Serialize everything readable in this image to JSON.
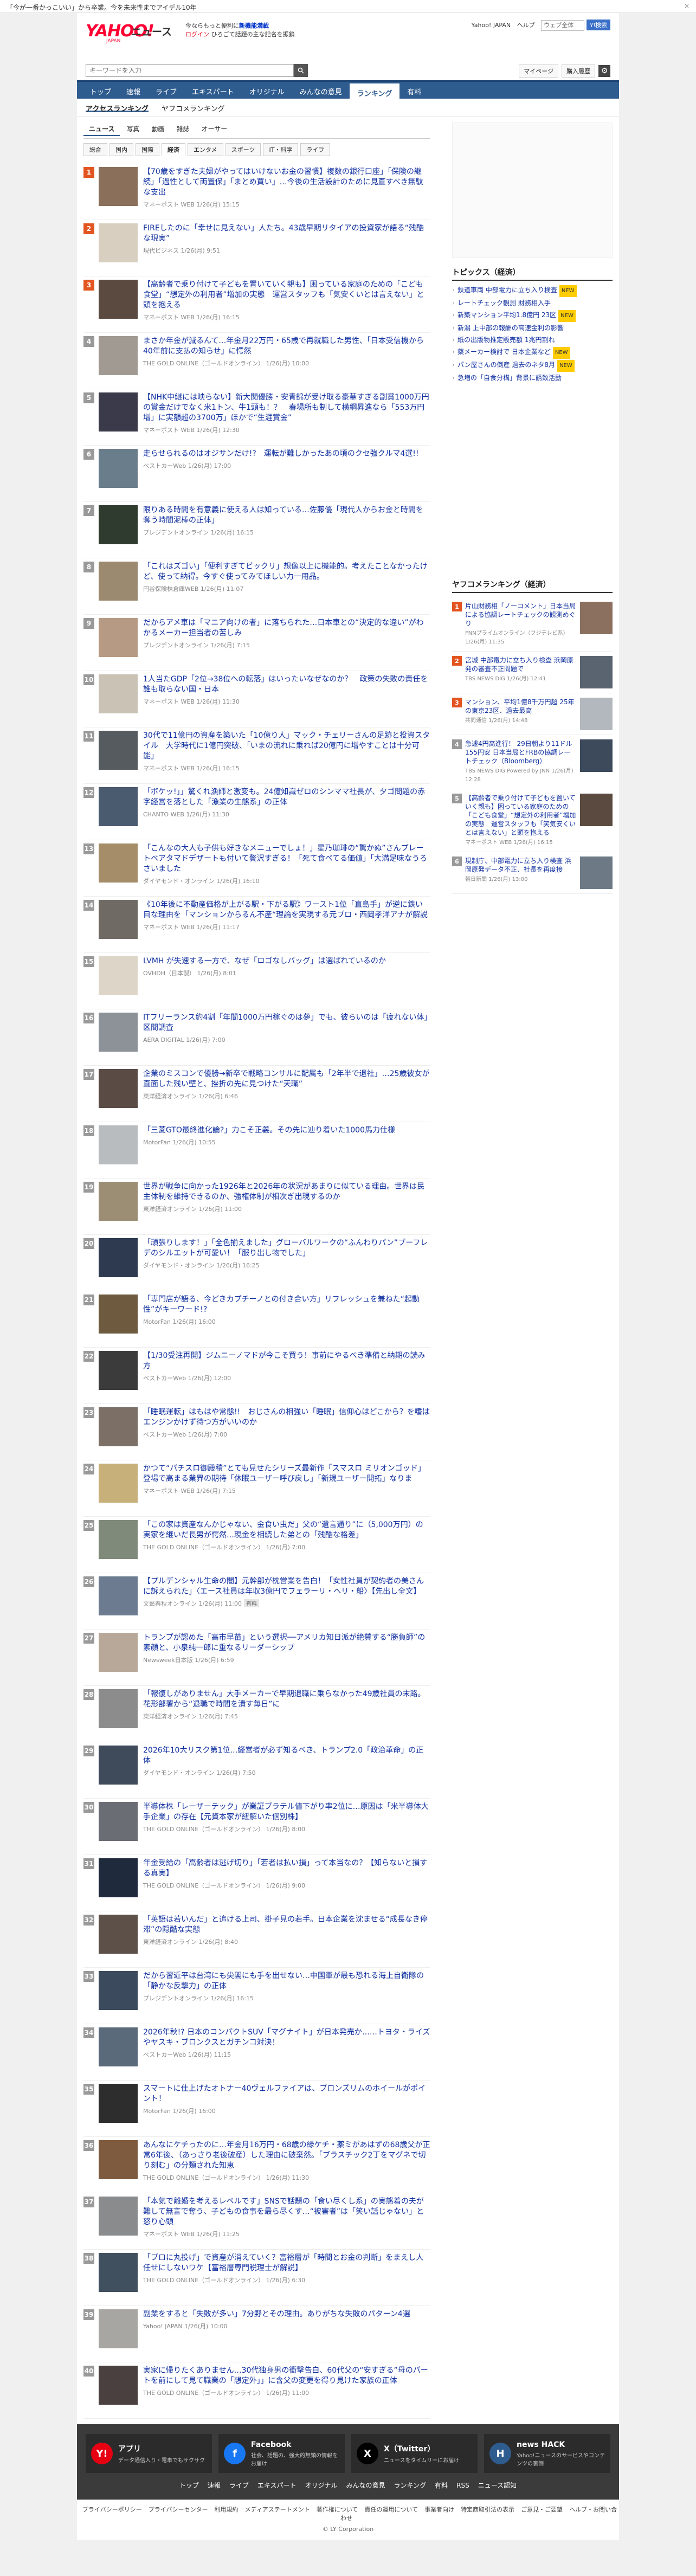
{
  "promo": {
    "text": "「今が一番かっこいい」から卒業。今を未来性までアイデル10年",
    "close": "×"
  },
  "header": {
    "logo": "YAHOO!",
    "logo_sub": "JAPAN",
    "site_name": "ニュース",
    "promo_line1": "今ならもっと便利に",
    "promo_highlight": "新機能満載",
    "promo_line2a": "ログイン",
    "promo_line2b": "ひろごて話題の主な記名を振鎖",
    "links": [
      "Yahoo! JAPAN",
      "ヘルプ"
    ],
    "mini_search_placeholder": "ウェブ全体",
    "mini_search_button": "Y!検索"
  },
  "search": {
    "placeholder": "キーワードを入力",
    "mypage": "マイページ",
    "subscribe": "購入履歴"
  },
  "gnav": [
    "トップ",
    "速報",
    "ライブ",
    "エキスパート",
    "オリジナル",
    "みんなの意見",
    "ランキング",
    "有料"
  ],
  "gnav_active": "ランキング",
  "subtabs": [
    "アクセスランキング",
    "ヤフコメランキング"
  ],
  "genre_tabs": [
    "ニュース",
    "写真",
    "動画",
    "雑誌",
    "オーサー"
  ],
  "sub_genre": [
    "総合",
    "国内",
    "国際",
    "経済",
    "エンタメ",
    "スポーツ",
    "IT・科学",
    "ライフ"
  ],
  "sub_genre_active": "経済",
  "ranking": [
    {
      "n": "1",
      "title": "【70歳をすぎた夫婦がやってはいけないお金の習慣】複数の銀行口座」「保険の継続」「過性として両置保」「まとめ買い」…今後の生活設計のために見直すべき無駄な支出",
      "source": "マネーポスト WEB",
      "time": "1/26(月) 15:15",
      "color": "#8a6f5a"
    },
    {
      "n": "2",
      "title": "FIREしたのに「幸せに見えない」人たち。43歳早期リタイアの投資家が語る“残酷な現実”",
      "source": "現代ビジネス",
      "time": "1/26(月) 9:51",
      "color": "#d8cfc0"
    },
    {
      "n": "3",
      "title": "【高齢者で乗り付けて子どもを置いていく親も】困っている家庭のための「こども食堂」“想定外の利用者”増加の実態　運営スタッフも「気安くいとは言えない」と頭を抱える",
      "source": "マネーポスト WEB",
      "time": "1/26(月) 16:15",
      "color": "#5b4a3f"
    },
    {
      "n": "4",
      "title": "まさか年金が減るんて…年金月22万円・65歳で再就職した男性、「日本受信機から40年前に支払の知らせ」に愕然",
      "source": "THE GOLD ONLINE（ゴールドオンライン）",
      "time": "1/26(月) 10:00",
      "color": "#a09a92"
    },
    {
      "n": "5",
      "title": "【NHK中継には映らない】新大関優勝・安青錦が受け取る豪華すぎる副賞1000万円の賞金だけでなく米1トン、牛1頭も！？　春場所も制して横綱昇進なら「553万円増」に実額超の3700万」ほかで“生涯賞金”",
      "source": "マネーポスト WEB",
      "time": "1/26(月) 12:30",
      "color": "#3a3a4a"
    },
    {
      "n": "6",
      "title": "走らせられるのはオジサンだけ!?　運転が難しかったあの頃のクセ強クルマ4選!!",
      "source": "ベストカーWeb",
      "time": "1/26(月) 17:00",
      "color": "#6a7d8a"
    },
    {
      "n": "7",
      "title": "限りある時間を有意義に使える人は知っている…佐藤優「現代人からお金と時間を奪う時間泥棒の正体」",
      "source": "プレジデントオンライン",
      "time": "1/26(月) 16:15",
      "color": "#2f3b2e"
    },
    {
      "n": "8",
      "title": "「これはズゴい」「便利すぎてビックリ」想像以上に機能的。考えたことなかったけど、使って納得。今すぐ使ってみてほしい力一用品。",
      "source": "円谷保険株倉庫WEB",
      "time": "1/26(月) 11:07",
      "color": "#9b8a70"
    },
    {
      "n": "9",
      "title": "だからアメ車は「マニア向けの者」に落ちられた…日本車との“決定的な違い”がわかるメーカー担当者の苦しみ",
      "source": "プレジデントオンライン",
      "time": "1/26(月) 7:15",
      "color": "#b79a83"
    },
    {
      "n": "10",
      "title": "1人当たGDP「2位→38位への転落」はいったいなぜなのか？　政策の失敗の責任を誰も取らない国・日本",
      "source": "マネーポスト WEB",
      "time": "1/26(月) 11:30",
      "color": "#c9c2b5"
    },
    {
      "n": "11",
      "title": "30代で11億円の資産を築いた「10億り人」マック・チェリーさんの足跡と投資スタイル　大学時代に1億円突破、「いまの流れに乗れば20億円に増やすことは十分可能」",
      "source": "マネーポスト WEB",
      "time": "1/26(月) 16:15",
      "color": "#565b60"
    },
    {
      "n": "12",
      "title": "「ボケッ!」」驚くれ漁師と激変も。24億知識ゼロのシンママ社長が、夕ゴ問題の赤字経営を落とした「漁業の生態系」の正体",
      "source": "CHANTO WEB",
      "time": "1/26(月) 11:30",
      "color": "#4a5a6f"
    },
    {
      "n": "13",
      "title": "「こんなの大人も子供も好きなメニューでしょ！」星乃珈琲の“驚かぬ”さんプレートベアタマドデザートも付いて贅沢すぎる！「死て食べてる価値」「大満足味なうろさいました",
      "source": "ダイヤモンド・オンライン",
      "time": "1/26(月) 16:10",
      "color": "#a58d6a"
    },
    {
      "n": "14",
      "title": "《10年後に不動産価格が上がる駅・下がる駅》ワースト1位「直島手」が逆に鉄い目な理由を「マンションからるん不産“理論を実現する元ブロ・西岡孝洋アナが解説",
      "source": "マネーポスト WEB",
      "time": "1/26(月) 11:17",
      "color": "#6f6a64"
    },
    {
      "n": "15",
      "title": "LVMH が失速する一方で、なぜ「ロゴなしバッグ」は選ばれているのか",
      "source": "OVHDH（日本製）",
      "time": "1/26(月) 8:01",
      "color": "#ddd5c8"
    },
    {
      "n": "16",
      "title": "ITフリーランス約4割「年間1000万円稼ぐのは夢」でも、彼らいのは「疲れない体」　区間調査",
      "source": "AERA DIGITAL",
      "time": "1/26(月) 7:00",
      "color": "#8c9298"
    },
    {
      "n": "17",
      "title": "企業のミスコンで優勝→新卒で戦略コンサルに配属も「2年半で退社」…25歳彼女が直面した残い壁と、挫折の先に見つけた“天職”",
      "source": "東洋経済オンライン",
      "time": "1/26(月) 6:46",
      "color": "#5a4c45"
    },
    {
      "n": "18",
      "title": "「三菱GTO最終進化論?」力こそ正義。その先に辿り着いた1000馬力仕様",
      "source": "MotorFan",
      "time": "1/26(月) 10:55",
      "color": "#b9bcbf"
    },
    {
      "n": "19",
      "title": "世界が戦争に向かった1926年と2026年の状況があまりに似ている理由。世界は民主体制を維持できるのか、強権体制が相次ぎ出現するのか",
      "source": "東洋経済オンライン",
      "time": "1/26(月) 11:00",
      "color": "#9c8d75"
    },
    {
      "n": "20",
      "title": "「頑張りします！」「全色揃えました」グローバルワークの“ふんわりパン”ブーフレデのシルエットが可愛い！「服り出し物でした」",
      "source": "ダイヤモンド・オンライン",
      "time": "1/26(月) 16:25",
      "color": "#2d3a4f"
    },
    {
      "n": "21",
      "title": "「専門店が語る、今どきカプチーノとの付き合い方」リフレッシュを兼ねた“起動性”がキーワード!?",
      "source": "MotorFan",
      "time": "1/26(月) 16:00",
      "color": "#6e5a3e"
    },
    {
      "n": "22",
      "title": "【1/30受注再開】ジムニーノマドが今こそ買う！事前にやるべき準備と納期の読み方",
      "source": "ベストカーWeb",
      "time": "1/26(月) 12:00",
      "color": "#3b3b3b"
    },
    {
      "n": "23",
      "title": "「睡眠運転」はもはや常態!!　おじさんの相強い「睡眠」信仰心はどこから？を嗜はエンジンかけず待つ方がいいのか",
      "source": "ベストカーWeb",
      "time": "1/26(月) 7:00",
      "color": "#7b6f66"
    },
    {
      "n": "24",
      "title": "かつて“パチスロ御殿積”とても見せたシリーズ最新作「スマスロ ミリオンゴッド」登場で高まる業界の期待「休眠ユーザー呼び戻し」「新規ユーザー開拓」なりま",
      "source": "マネーポスト WEB",
      "time": "1/26(月) 7:15",
      "color": "#c8b07a"
    },
    {
      "n": "25",
      "title": "「この家は資産なんかじゃない、金食い虫だ」父の“遺言通り”に（5,000万円）の実家を継いだ長男が愕然…現金を相続した弟との「残酷な格差」",
      "source": "THE GOLD ONLINE（ゴールドオンライン）",
      "time": "1/26(月) 7:00",
      "color": "#7f8a7a"
    },
    {
      "n": "26",
      "title": "【プルデンシャル生命の闇】元幹部が枕営業を告白！「女性社員が契約者の美さんに訴えられた」〈エース社員は年収3億円でフェラーリ・ヘリ・船〉【先出し全文】",
      "source": "文藝春秋オンライン",
      "time": "1/26(月) 11:00",
      "color": "#6c7b8f",
      "badge": "有料"
    },
    {
      "n": "27",
      "title": "トランプが認めた「高市早苗」という選択──アメリカ知日派が絶賛する“勝負師”の素顔と、小泉純一郎に重なるリーダーシップ",
      "source": "Newsweek日本版",
      "time": "1/26(月) 6:59",
      "color": "#b8a899"
    },
    {
      "n": "28",
      "title": "「報復しがありません」大手メーカーで早期退職に乗らなかった49歳社員の末路。花形部署から“退職で時間を潰す毎日”に",
      "source": "東洋経済オンライン",
      "time": "1/26(月) 7:45",
      "color": "#8c8c8c"
    },
    {
      "n": "29",
      "title": "2026年10大リスク第1位…経営者が必ず知るべき、トランプ2.0「政治革命」の正体",
      "source": "ダイヤモンド・オンライン",
      "time": "1/26(月) 7:50",
      "color": "#3f4b5a"
    },
    {
      "n": "30",
      "title": "半導体株「レーザーテック」が業証ブラテル値下がり率2位に…原因は「米半導体大手企業」の存在【元資本家が紐解いた個別株】",
      "source": "THE GOLD ONLINE（ゴールドオンライン）",
      "time": "1/26(月) 8:00",
      "color": "#6a6d73"
    },
    {
      "n": "31",
      "title": "年金受給の「高齢者は逃げ切り」「若者は払い損」って本当なの？【知らないと損する真実】",
      "source": "THE GOLD ONLINE（ゴールドオンライン）",
      "time": "1/26(月) 9:00",
      "color": "#1f2a3c"
    },
    {
      "n": "32",
      "title": "「英語は若いんだ」と追ける上司、掛子見の若手。日本企業を沈ませる“成長なき停滞”の隠酷な実態",
      "source": "東洋経済オンライン",
      "time": "1/26(月) 8:40",
      "color": "#5c5048"
    },
    {
      "n": "33",
      "title": "だから習近平は台湾にも尖閣にも手を出せない…中国軍が最も恐れる海上自衛隊の「静かな反撃力」の正体",
      "source": "プレジデントオンライン",
      "time": "1/26(月) 16:15",
      "color": "#3b4a5c"
    },
    {
      "n": "34",
      "title": "2026年秋!? 日本のコンパクトSUV「マグナイト」が日本発売か……トヨタ・ライズやヤスキ・ブロンクスとガチンコ対決！",
      "source": "ベストカーWeb",
      "time": "1/26(月) 11:15",
      "color": "#5a6a7a"
    },
    {
      "n": "35",
      "title": "スマートに仕上げたオトナー40ヴェルファイアは、ブロンズリムのホイールがポイント！",
      "source": "MotorFan",
      "time": "1/26(月) 16:00",
      "color": "#2d2d2d"
    },
    {
      "n": "36",
      "title": "あんなにケチったのに…年金月16万円・68歳の緑ケチ・薬ミがあはずの68歳父が正常6年後、（あっさり老後破産）した理由に破棄然。「ブラスチック2丁をマグネで切り刻む」の分類された知恵",
      "source": "THE GOLD ONLINE（ゴールドオンライン）",
      "time": "1/26(月) 11:30",
      "color": "#7e5b3f"
    },
    {
      "n": "37",
      "title": "「本気で離婚を考えるレベルです」SNSで話題の「食い尽くし系」の実態着の夫が難して無言で奪う、子どもの食事を最ら尽くす…“被害者”は「笑い話じゃない」と怒り心頭",
      "source": "マネーポスト WEB",
      "time": "1/26(月) 11:25",
      "color": "#8a8b8c"
    },
    {
      "n": "38",
      "title": "「プロに丸投げ」で資産が消えていく？富裕層が「時間とお金の判断」をまえし人任せにしないワケ【富裕層専門税理士が解説】",
      "source": "THE GOLD ONLINE（ゴールドオンライン）",
      "time": "1/26(月) 6:30",
      "color": "#40505f"
    },
    {
      "n": "39",
      "title": "副業をすると「失敗が多い」7分野とその理由。ありがちな失敗のパターン4選",
      "source": "Yahoo! JAPAN",
      "time": "1/26(月) 10:00",
      "color": "#a8a6a2"
    },
    {
      "n": "40",
      "title": "実家に帰りたくありません…30代独身男の衝撃告白、60代父の“安すぎる”母のパートを前にして見て職業の「想定外」」に含父の変更を得り見けた家族の正体",
      "source": "THE GOLD ONLINE（ゴールドオンライン）",
      "time": "1/26(月) 11:00",
      "color": "#4a4040"
    }
  ],
  "sidebar": {
    "topics_title": "トピックス（経済）",
    "topics": [
      {
        "t": "鉄道車両 中部電力に立ち入り検査",
        "new": true
      },
      {
        "t": "レートチェック観測 財務相入手",
        "new": false
      },
      {
        "t": "新築マンション平均1.8億円 23区",
        "new": true
      },
      {
        "t": "新潟 上中部の報酬の高速金利の影響",
        "new": false
      },
      {
        "t": "紙の出版物推定販売額 1兆円割れ",
        "new": false
      },
      {
        "t": "薬メーカー検討で 日本企業など",
        "new": true
      },
      {
        "t": "パン屋さんの倒産 過去のネタ8月",
        "new": true
      },
      {
        "t": "急増の「自食分構」背景に誘致活動",
        "new": false
      }
    ],
    "yahoo_rank_title": "ヤフコメランキング（経済）",
    "yahoo_rank": [
      {
        "n": "1",
        "t": "片山財務相「ノーコメント」日本当局による協調レートチェックの観測めぐり",
        "m": "FNNプライムオンライン（フジテレビ系）1/26(月) 11:35",
        "color": "#8b6f5f"
      },
      {
        "n": "2",
        "t": "宮城 中部電力に立ち入り検査 浜岡原発の審査不正問題で",
        "m": "TBS NEWS DIG 1/26(月) 12:41",
        "color": "#5a6470"
      },
      {
        "n": "3",
        "t": "マンション、平均1億8千万円超 25年の東京23区、過去最高",
        "m": "共同通信 1/26(月) 14:48",
        "color": "#b3b8be"
      },
      {
        "n": "4",
        "t": "急遽4円高進行！ 29日朝より11ドル155円安 日本当局とFRBの協調レートチェック（Bloomberg）",
        "m": "TBS NEWS DIG Powered by JNN 1/26(月) 12:28",
        "color": "#3c4a5c"
      },
      {
        "n": "5",
        "t": "【高齢者で乗り付けて子どもを置いていく親も】困っている家庭のための「こども食堂」“想定外の利用者”増加の実態　運営スタッフも「笑気安くいとは言えない」と頭を抱える",
        "m": "マネーポスト WEB 1/26(月) 16:15",
        "color": "#5b4a3f"
      },
      {
        "n": "6",
        "t": "現制庁、中部電力に立ち入り検査 浜岡原発データ不正、社長を再度接",
        "m": "朝日新聞 1/26(月) 13:00",
        "color": "#6d7a86"
      }
    ]
  },
  "footer": {
    "boxes": [
      {
        "title": "アプリ",
        "desc": "データ通信入り・電車でもサクサク",
        "icon": "Y!",
        "color": "#e60012"
      },
      {
        "title": "Facebook",
        "desc": "社会、話題の、強大的無類の情報をお届け",
        "icon": "f",
        "color": "#1877f2"
      },
      {
        "title": "X（Twitter）",
        "desc": "ニュースをタイムリーにお届け",
        "icon": "X",
        "color": "#000000"
      },
      {
        "title": "news HACK",
        "desc": "Yahoo!ニュースのサービスやコンテンツの裏側",
        "icon": "H",
        "color": "#2f5c8f"
      }
    ],
    "links": [
      "トップ",
      "速報",
      "ライブ",
      "エキスパート",
      "オリジナル",
      "みんなの意見",
      "ランキング",
      "有料",
      "RSS",
      "ニュース認知"
    ],
    "legal": [
      "プライバシーポリシー",
      "プライバシーセンター",
      "利用規約",
      "メディアステートメント",
      "著作権について",
      "責任の運用について",
      "事業者向け",
      "特定商取引法の表示",
      "ご意見・ご要望",
      "ヘルプ・お問い合わせ"
    ],
    "copyright": "© LY Corporation"
  }
}
